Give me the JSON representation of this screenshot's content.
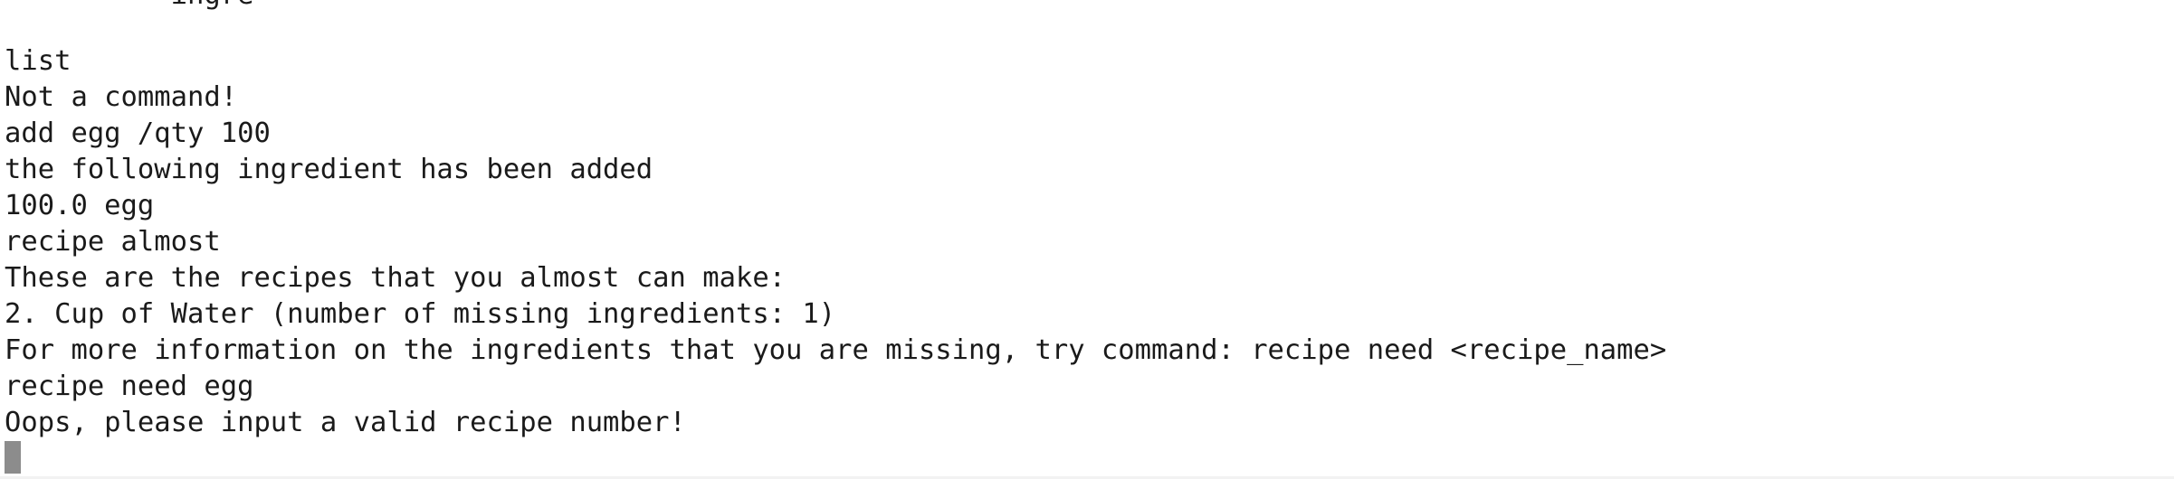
{
  "terminal": {
    "lines": [
      "list",
      "Not a command!",
      "add egg /qty 100",
      "the following ingredient has been added",
      "100.0 egg",
      "recipe almost",
      "These are the recipes that you almost can make:",
      "2. Cup of Water (number of missing ingredients: 1)",
      "For more information on the ingredients that you are missing, try command: recipe need <recipe_name>",
      "recipe need egg",
      "Oops, please input a valid recipe number!"
    ]
  }
}
